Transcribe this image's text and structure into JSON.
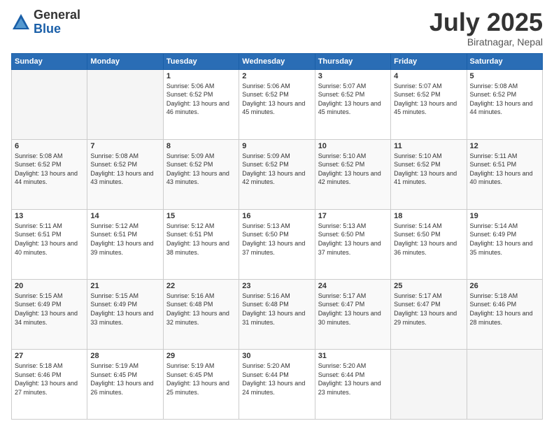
{
  "logo": {
    "general": "General",
    "blue": "Blue"
  },
  "title": "July 2025",
  "subtitle": "Biratnagar, Nepal",
  "headers": [
    "Sunday",
    "Monday",
    "Tuesday",
    "Wednesday",
    "Thursday",
    "Friday",
    "Saturday"
  ],
  "weeks": [
    [
      {
        "day": "",
        "info": ""
      },
      {
        "day": "",
        "info": ""
      },
      {
        "day": "1",
        "info": "Sunrise: 5:06 AM\nSunset: 6:52 PM\nDaylight: 13 hours and 46 minutes."
      },
      {
        "day": "2",
        "info": "Sunrise: 5:06 AM\nSunset: 6:52 PM\nDaylight: 13 hours and 45 minutes."
      },
      {
        "day": "3",
        "info": "Sunrise: 5:07 AM\nSunset: 6:52 PM\nDaylight: 13 hours and 45 minutes."
      },
      {
        "day": "4",
        "info": "Sunrise: 5:07 AM\nSunset: 6:52 PM\nDaylight: 13 hours and 45 minutes."
      },
      {
        "day": "5",
        "info": "Sunrise: 5:08 AM\nSunset: 6:52 PM\nDaylight: 13 hours and 44 minutes."
      }
    ],
    [
      {
        "day": "6",
        "info": "Sunrise: 5:08 AM\nSunset: 6:52 PM\nDaylight: 13 hours and 44 minutes."
      },
      {
        "day": "7",
        "info": "Sunrise: 5:08 AM\nSunset: 6:52 PM\nDaylight: 13 hours and 43 minutes."
      },
      {
        "day": "8",
        "info": "Sunrise: 5:09 AM\nSunset: 6:52 PM\nDaylight: 13 hours and 43 minutes."
      },
      {
        "day": "9",
        "info": "Sunrise: 5:09 AM\nSunset: 6:52 PM\nDaylight: 13 hours and 42 minutes."
      },
      {
        "day": "10",
        "info": "Sunrise: 5:10 AM\nSunset: 6:52 PM\nDaylight: 13 hours and 42 minutes."
      },
      {
        "day": "11",
        "info": "Sunrise: 5:10 AM\nSunset: 6:52 PM\nDaylight: 13 hours and 41 minutes."
      },
      {
        "day": "12",
        "info": "Sunrise: 5:11 AM\nSunset: 6:51 PM\nDaylight: 13 hours and 40 minutes."
      }
    ],
    [
      {
        "day": "13",
        "info": "Sunrise: 5:11 AM\nSunset: 6:51 PM\nDaylight: 13 hours and 40 minutes."
      },
      {
        "day": "14",
        "info": "Sunrise: 5:12 AM\nSunset: 6:51 PM\nDaylight: 13 hours and 39 minutes."
      },
      {
        "day": "15",
        "info": "Sunrise: 5:12 AM\nSunset: 6:51 PM\nDaylight: 13 hours and 38 minutes."
      },
      {
        "day": "16",
        "info": "Sunrise: 5:13 AM\nSunset: 6:50 PM\nDaylight: 13 hours and 37 minutes."
      },
      {
        "day": "17",
        "info": "Sunrise: 5:13 AM\nSunset: 6:50 PM\nDaylight: 13 hours and 37 minutes."
      },
      {
        "day": "18",
        "info": "Sunrise: 5:14 AM\nSunset: 6:50 PM\nDaylight: 13 hours and 36 minutes."
      },
      {
        "day": "19",
        "info": "Sunrise: 5:14 AM\nSunset: 6:49 PM\nDaylight: 13 hours and 35 minutes."
      }
    ],
    [
      {
        "day": "20",
        "info": "Sunrise: 5:15 AM\nSunset: 6:49 PM\nDaylight: 13 hours and 34 minutes."
      },
      {
        "day": "21",
        "info": "Sunrise: 5:15 AM\nSunset: 6:49 PM\nDaylight: 13 hours and 33 minutes."
      },
      {
        "day": "22",
        "info": "Sunrise: 5:16 AM\nSunset: 6:48 PM\nDaylight: 13 hours and 32 minutes."
      },
      {
        "day": "23",
        "info": "Sunrise: 5:16 AM\nSunset: 6:48 PM\nDaylight: 13 hours and 31 minutes."
      },
      {
        "day": "24",
        "info": "Sunrise: 5:17 AM\nSunset: 6:47 PM\nDaylight: 13 hours and 30 minutes."
      },
      {
        "day": "25",
        "info": "Sunrise: 5:17 AM\nSunset: 6:47 PM\nDaylight: 13 hours and 29 minutes."
      },
      {
        "day": "26",
        "info": "Sunrise: 5:18 AM\nSunset: 6:46 PM\nDaylight: 13 hours and 28 minutes."
      }
    ],
    [
      {
        "day": "27",
        "info": "Sunrise: 5:18 AM\nSunset: 6:46 PM\nDaylight: 13 hours and 27 minutes."
      },
      {
        "day": "28",
        "info": "Sunrise: 5:19 AM\nSunset: 6:45 PM\nDaylight: 13 hours and 26 minutes."
      },
      {
        "day": "29",
        "info": "Sunrise: 5:19 AM\nSunset: 6:45 PM\nDaylight: 13 hours and 25 minutes."
      },
      {
        "day": "30",
        "info": "Sunrise: 5:20 AM\nSunset: 6:44 PM\nDaylight: 13 hours and 24 minutes."
      },
      {
        "day": "31",
        "info": "Sunrise: 5:20 AM\nSunset: 6:44 PM\nDaylight: 13 hours and 23 minutes."
      },
      {
        "day": "",
        "info": ""
      },
      {
        "day": "",
        "info": ""
      }
    ]
  ]
}
